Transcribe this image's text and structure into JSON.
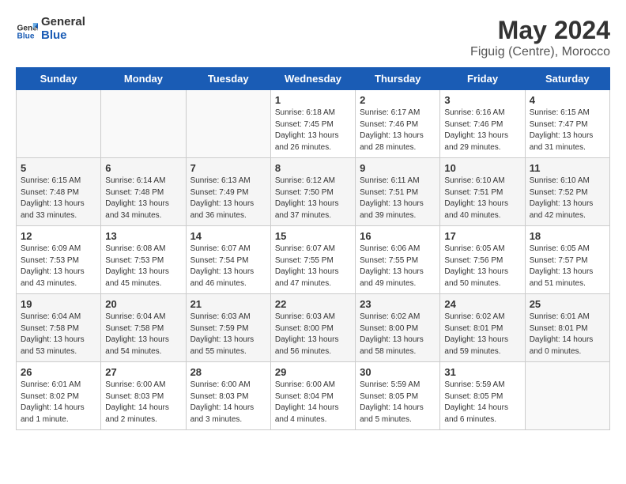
{
  "logo": {
    "line1": "General",
    "line2": "Blue"
  },
  "title": "May 2024",
  "location": "Figuig (Centre), Morocco",
  "days_header": [
    "Sunday",
    "Monday",
    "Tuesday",
    "Wednesday",
    "Thursday",
    "Friday",
    "Saturday"
  ],
  "weeks": [
    [
      {
        "num": "",
        "info": ""
      },
      {
        "num": "",
        "info": ""
      },
      {
        "num": "",
        "info": ""
      },
      {
        "num": "1",
        "info": "Sunrise: 6:18 AM\nSunset: 7:45 PM\nDaylight: 13 hours\nand 26 minutes."
      },
      {
        "num": "2",
        "info": "Sunrise: 6:17 AM\nSunset: 7:46 PM\nDaylight: 13 hours\nand 28 minutes."
      },
      {
        "num": "3",
        "info": "Sunrise: 6:16 AM\nSunset: 7:46 PM\nDaylight: 13 hours\nand 29 minutes."
      },
      {
        "num": "4",
        "info": "Sunrise: 6:15 AM\nSunset: 7:47 PM\nDaylight: 13 hours\nand 31 minutes."
      }
    ],
    [
      {
        "num": "5",
        "info": "Sunrise: 6:15 AM\nSunset: 7:48 PM\nDaylight: 13 hours\nand 33 minutes."
      },
      {
        "num": "6",
        "info": "Sunrise: 6:14 AM\nSunset: 7:48 PM\nDaylight: 13 hours\nand 34 minutes."
      },
      {
        "num": "7",
        "info": "Sunrise: 6:13 AM\nSunset: 7:49 PM\nDaylight: 13 hours\nand 36 minutes."
      },
      {
        "num": "8",
        "info": "Sunrise: 6:12 AM\nSunset: 7:50 PM\nDaylight: 13 hours\nand 37 minutes."
      },
      {
        "num": "9",
        "info": "Sunrise: 6:11 AM\nSunset: 7:51 PM\nDaylight: 13 hours\nand 39 minutes."
      },
      {
        "num": "10",
        "info": "Sunrise: 6:10 AM\nSunset: 7:51 PM\nDaylight: 13 hours\nand 40 minutes."
      },
      {
        "num": "11",
        "info": "Sunrise: 6:10 AM\nSunset: 7:52 PM\nDaylight: 13 hours\nand 42 minutes."
      }
    ],
    [
      {
        "num": "12",
        "info": "Sunrise: 6:09 AM\nSunset: 7:53 PM\nDaylight: 13 hours\nand 43 minutes."
      },
      {
        "num": "13",
        "info": "Sunrise: 6:08 AM\nSunset: 7:53 PM\nDaylight: 13 hours\nand 45 minutes."
      },
      {
        "num": "14",
        "info": "Sunrise: 6:07 AM\nSunset: 7:54 PM\nDaylight: 13 hours\nand 46 minutes."
      },
      {
        "num": "15",
        "info": "Sunrise: 6:07 AM\nSunset: 7:55 PM\nDaylight: 13 hours\nand 47 minutes."
      },
      {
        "num": "16",
        "info": "Sunrise: 6:06 AM\nSunset: 7:55 PM\nDaylight: 13 hours\nand 49 minutes."
      },
      {
        "num": "17",
        "info": "Sunrise: 6:05 AM\nSunset: 7:56 PM\nDaylight: 13 hours\nand 50 minutes."
      },
      {
        "num": "18",
        "info": "Sunrise: 6:05 AM\nSunset: 7:57 PM\nDaylight: 13 hours\nand 51 minutes."
      }
    ],
    [
      {
        "num": "19",
        "info": "Sunrise: 6:04 AM\nSunset: 7:58 PM\nDaylight: 13 hours\nand 53 minutes."
      },
      {
        "num": "20",
        "info": "Sunrise: 6:04 AM\nSunset: 7:58 PM\nDaylight: 13 hours\nand 54 minutes."
      },
      {
        "num": "21",
        "info": "Sunrise: 6:03 AM\nSunset: 7:59 PM\nDaylight: 13 hours\nand 55 minutes."
      },
      {
        "num": "22",
        "info": "Sunrise: 6:03 AM\nSunset: 8:00 PM\nDaylight: 13 hours\nand 56 minutes."
      },
      {
        "num": "23",
        "info": "Sunrise: 6:02 AM\nSunset: 8:00 PM\nDaylight: 13 hours\nand 58 minutes."
      },
      {
        "num": "24",
        "info": "Sunrise: 6:02 AM\nSunset: 8:01 PM\nDaylight: 13 hours\nand 59 minutes."
      },
      {
        "num": "25",
        "info": "Sunrise: 6:01 AM\nSunset: 8:01 PM\nDaylight: 14 hours\nand 0 minutes."
      }
    ],
    [
      {
        "num": "26",
        "info": "Sunrise: 6:01 AM\nSunset: 8:02 PM\nDaylight: 14 hours\nand 1 minute."
      },
      {
        "num": "27",
        "info": "Sunrise: 6:00 AM\nSunset: 8:03 PM\nDaylight: 14 hours\nand 2 minutes."
      },
      {
        "num": "28",
        "info": "Sunrise: 6:00 AM\nSunset: 8:03 PM\nDaylight: 14 hours\nand 3 minutes."
      },
      {
        "num": "29",
        "info": "Sunrise: 6:00 AM\nSunset: 8:04 PM\nDaylight: 14 hours\nand 4 minutes."
      },
      {
        "num": "30",
        "info": "Sunrise: 5:59 AM\nSunset: 8:05 PM\nDaylight: 14 hours\nand 5 minutes."
      },
      {
        "num": "31",
        "info": "Sunrise: 5:59 AM\nSunset: 8:05 PM\nDaylight: 14 hours\nand 6 minutes."
      },
      {
        "num": "",
        "info": ""
      }
    ]
  ]
}
